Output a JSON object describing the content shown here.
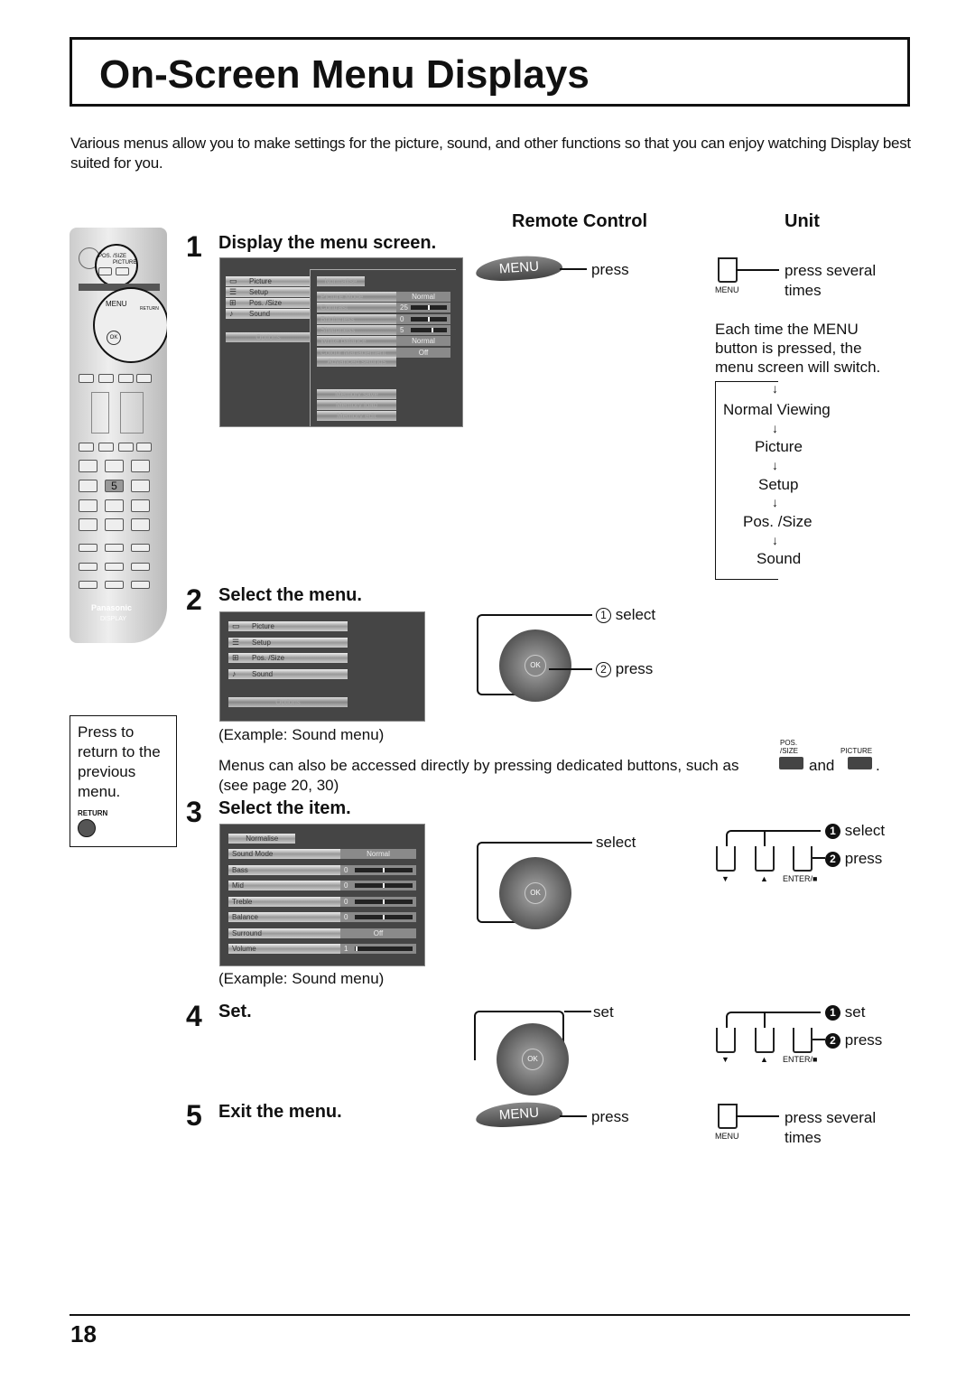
{
  "title": "On-Screen Menu Displays",
  "intro": "Various menus allow you to make settings for the picture, sound, and other functions so that you can enjoy watching Display best suited for you.",
  "columns": {
    "remote": "Remote Control",
    "unit": "Unit"
  },
  "remote": {
    "pos_size": "POS. /SIZE",
    "picture": "PICTURE",
    "menu": "MENU",
    "return": "RETURN",
    "ok": "OK",
    "five": "5",
    "brand": "Panasonic",
    "display": "DISPLAY"
  },
  "steps": [
    {
      "num": "1",
      "heading": "Display the menu screen."
    },
    {
      "num": "2",
      "heading": "Select the menu."
    },
    {
      "num": "3",
      "heading": "Select the item."
    },
    {
      "num": "4",
      "heading": "Set."
    },
    {
      "num": "5",
      "heading": "Exit the menu."
    }
  ],
  "menu_main": [
    "Picture",
    "Setup",
    "Pos. /Size",
    "Sound"
  ],
  "menu_options": "Options",
  "picture_menu": {
    "normalise": "Normalise",
    "items": [
      {
        "label": "Picture Mode",
        "value": "Normal"
      },
      {
        "label": "Contrast",
        "value": "25",
        "bar": 0.5
      },
      {
        "label": "Brightness",
        "value": "0",
        "bar": 0.5
      },
      {
        "label": "Sharpness",
        "value": "5",
        "bar": 0.6
      },
      {
        "label": "White balance",
        "value": "Normal"
      },
      {
        "label": "Colour Management",
        "value": "Off"
      }
    ],
    "advanced": "Advanced settings",
    "memory": [
      "Memory save",
      "Memory load",
      "Memory edit"
    ]
  },
  "sound_menu": {
    "normalise": "Normalise",
    "items": [
      {
        "label": "Sound Mode",
        "value": "Normal"
      },
      {
        "label": "Bass",
        "value": "0",
        "bar": 0.5
      },
      {
        "label": "Mid",
        "value": "0",
        "bar": 0.5
      },
      {
        "label": "Treble",
        "value": "0",
        "bar": 0.5
      },
      {
        "label": "Balance",
        "value": "0",
        "bar": 0.5
      },
      {
        "label": "Surround",
        "value": "Off"
      },
      {
        "label": "Volume",
        "value": "1",
        "bar": 0.01
      }
    ]
  },
  "labels": {
    "menu_btn": "MENU",
    "press": "press",
    "press_several": "press several",
    "times": "times",
    "menu_small": "MENU",
    "each_time": "Each time the MENU button is pressed, the menu screen will switch.",
    "select_1": "select",
    "press_2": "press",
    "circ1": "1",
    "circ2": "2",
    "ok": "OK",
    "example": "(Example: Sound menu)",
    "direct": "Menus can also be accessed directly by pressing dedicated buttons, such as",
    "and": "and",
    "period": ".",
    "see_page": "(see page 20, 30)",
    "pos_size": "POS. /SIZE",
    "picture": "PICTURE",
    "select": "select",
    "set": "set",
    "enter": "ENTER/■",
    "down": "▼",
    "up": "▲"
  },
  "flow": [
    "Normal Viewing",
    "Picture",
    "Setup",
    "Pos. /Size",
    "Sound"
  ],
  "return_box": {
    "text": "Press to return to the previous menu.",
    "label": "RETURN"
  },
  "page_number": "18"
}
